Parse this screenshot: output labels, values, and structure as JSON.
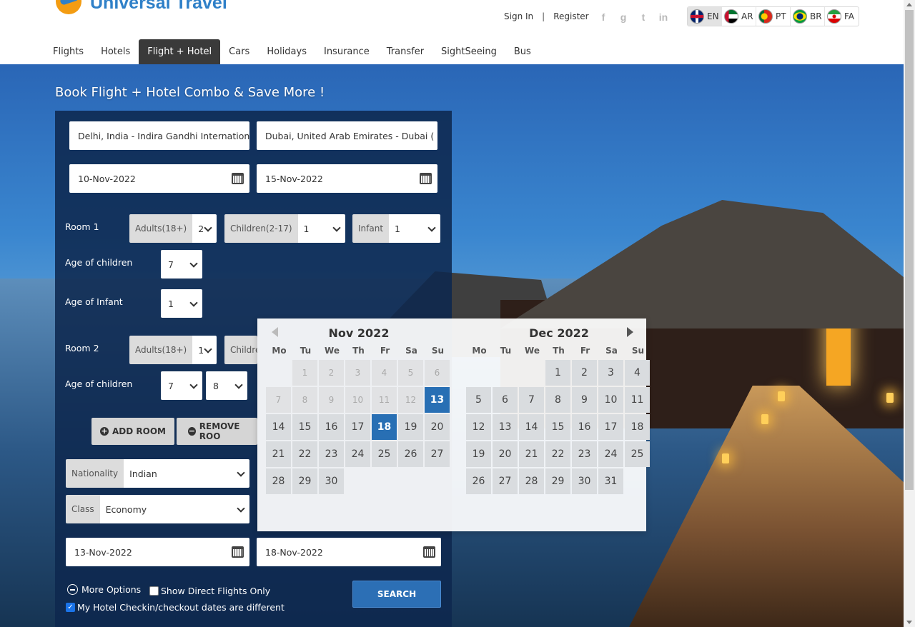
{
  "brand": {
    "name": "Universal Travel"
  },
  "auth": {
    "signin": "Sign In",
    "separator": "|",
    "register": "Register"
  },
  "social": [
    "facebook-icon",
    "google-icon",
    "twitter-icon",
    "linkedin-icon"
  ],
  "social_glyphs": [
    "f",
    "g",
    "t",
    "in"
  ],
  "languages": [
    {
      "code": "EN",
      "flag": "uk-flag-icon",
      "active": true
    },
    {
      "code": "AR",
      "flag": "uae-flag-icon",
      "active": false
    },
    {
      "code": "PT",
      "flag": "portugal-flag-icon",
      "active": false
    },
    {
      "code": "BR",
      "flag": "brazil-flag-icon",
      "active": false
    },
    {
      "code": "FA",
      "flag": "iran-flag-icon",
      "active": false
    }
  ],
  "nav": [
    "Flights",
    "Hotels",
    "Flight + Hotel",
    "Cars",
    "Holidays",
    "Insurance",
    "Transfer",
    "SightSeeing",
    "Bus"
  ],
  "nav_active": "Flight + Hotel",
  "hero": {
    "title": "Book Flight + Hotel Combo & Save More !"
  },
  "search": {
    "from": "Delhi, India - Indira Gandhi Internation",
    "to": "Dubai, United Arab Emirates - Dubai  (",
    "depart": "10-Nov-2022",
    "return": "15-Nov-2022",
    "room1": {
      "label": "Room 1",
      "adults_label": "Adults(18+)",
      "adults": "2",
      "children_label": "Children(2-17)",
      "children": "1",
      "infant_label": "Infant",
      "infant": "1",
      "age_children_label": "Age of children",
      "age_children": "7",
      "age_infant_label": "Age of Infant",
      "age_infant": "1"
    },
    "room2": {
      "label": "Room 2",
      "adults_label": "Adults(18+)",
      "adults": "1",
      "children_label": "Childre",
      "age_children_label": "Age of children",
      "age_child1": "7",
      "age_child2": "8"
    },
    "add_room": "ADD ROOM",
    "remove_room": "REMOVE ROO",
    "nationality_label": "Nationality",
    "nationality": "Indian",
    "class_label": "Class",
    "class": "Economy",
    "checkin": "13-Nov-2022",
    "checkout": "18-Nov-2022",
    "more_options": "More Options",
    "direct_flights": "Show Direct Flights Only",
    "hotel_dates_diff": "My Hotel Checkin/checkout dates are different",
    "search_btn": "SEARCH"
  },
  "datepicker": {
    "dows": [
      "Mo",
      "Tu",
      "We",
      "Th",
      "Fr",
      "Sa",
      "Su"
    ],
    "months": [
      {
        "title": "Nov 2022",
        "lead": 1,
        "days": 30,
        "disabled_until": 12,
        "selected": [
          13,
          18
        ]
      },
      {
        "title": "Dec 2022",
        "lead": 3,
        "days": 31,
        "disabled_until": 0,
        "selected": []
      }
    ]
  },
  "colors": {
    "accent": "#286fb4",
    "panel": "#0e284e",
    "nav_active": "#3a3a3a",
    "brand": "#2f80c8"
  }
}
